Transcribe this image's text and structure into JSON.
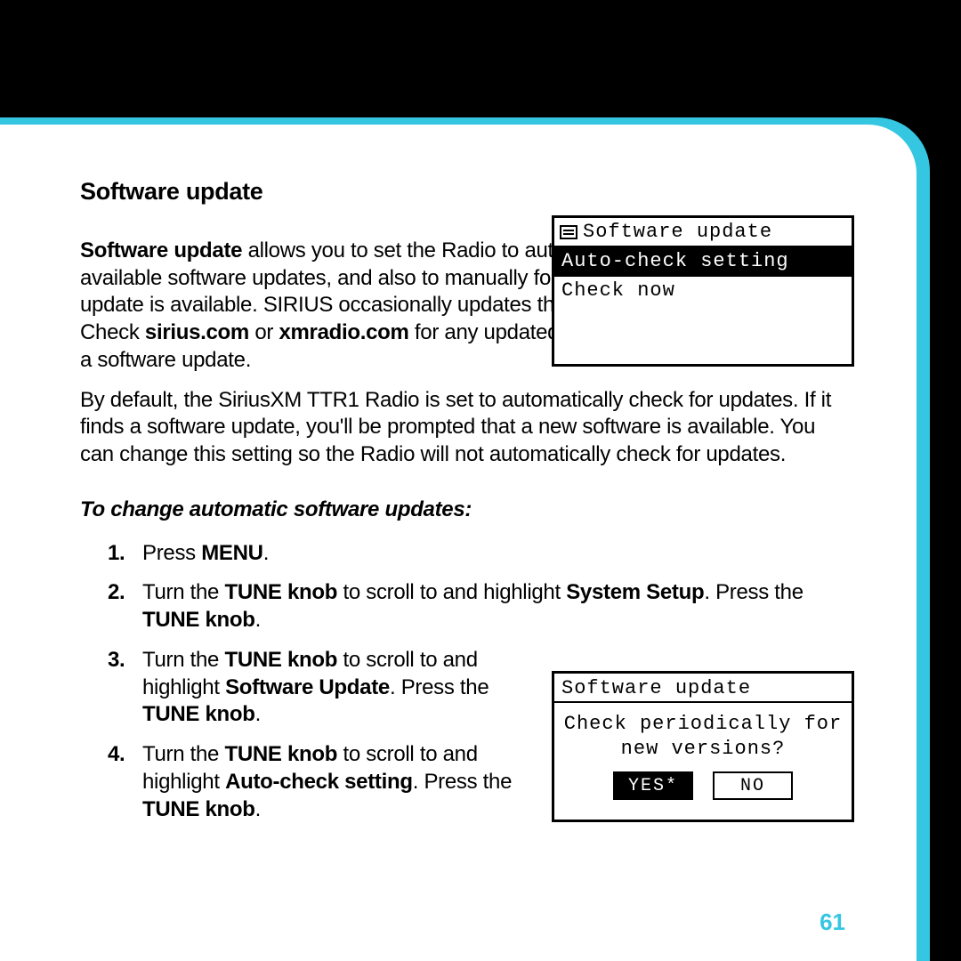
{
  "page_number": "61",
  "section_title": "Software update",
  "intro_bold": "Software update",
  "intro_text_1a": " allows you to set the Radio to automatically check for any available software updates, and also to manually force the Radio to check if an update is available. SIRIUS occasionally updates the software for their Radios. Check ",
  "intro_link1": "sirius.com",
  "intro_or": " or ",
  "intro_link2": "xmradio.com",
  "intro_text_1b": " for any updated documentation associated with a software update.",
  "para2": "By default, the SiriusXM TTR1 Radio is set to automatically check for updates. If it finds a software update, you'll be prompted that a new software is available. You can change this setting so the Radio will not automatically check for updates.",
  "subhead": "To change automatic software updates:",
  "steps": [
    {
      "n": "1.",
      "a": "Press ",
      "b": "MENU",
      "c": "."
    },
    {
      "n": "2.",
      "a": "Turn the ",
      "b": "TUNE knob",
      "c": " to scroll to and highlight ",
      "d": "System Setup",
      "e": ". Press the ",
      "f": "TUNE knob",
      "g": "."
    },
    {
      "n": "3.",
      "a": "Turn the ",
      "b": "TUNE knob",
      "c": " to scroll to and highlight ",
      "d": "Software Update",
      "e": ". Press the ",
      "f": "TUNE knob",
      "g": "."
    },
    {
      "n": "4.",
      "a": "Turn the ",
      "b": "TUNE knob",
      "c": " to scroll to and highlight ",
      "d": "Auto-check setting",
      "e": ". Press the ",
      "f": "TUNE knob",
      "g": "."
    }
  ],
  "lcd1": {
    "title": "Software update",
    "row_selected": "Auto-check setting",
    "row2": "Check now"
  },
  "lcd2": {
    "title": "Software update",
    "msg_line1": "Check periodically for",
    "msg_line2": "new versions?",
    "yes": "YES*",
    "no": "NO"
  }
}
